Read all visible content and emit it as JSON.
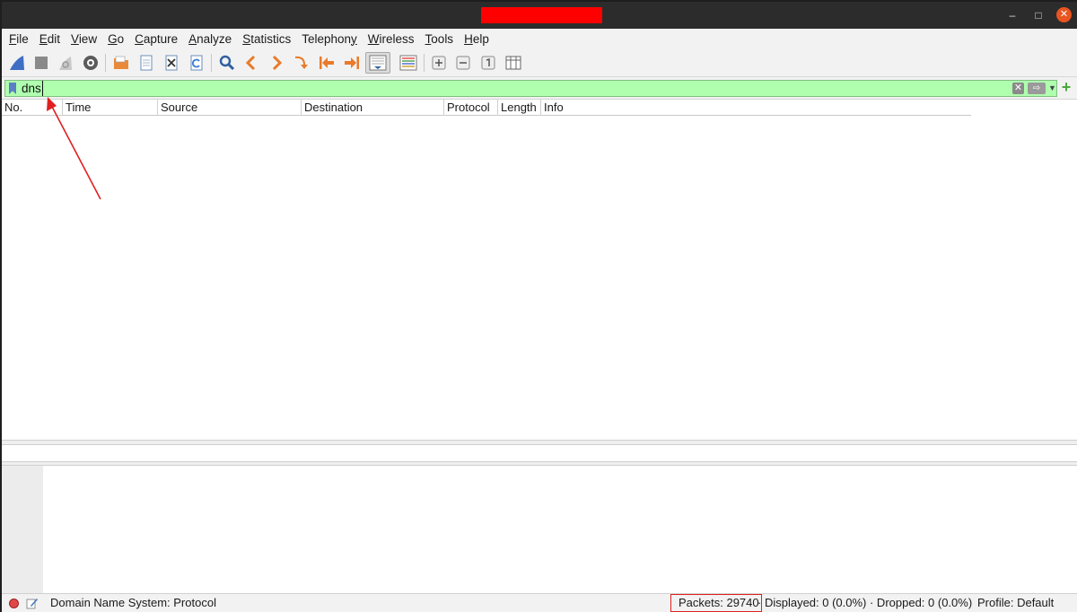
{
  "window": {
    "title_redacted": true,
    "controls": {
      "minimize": "–",
      "maximize": "□",
      "close": "✕"
    }
  },
  "menu": {
    "items": [
      {
        "label": "File",
        "mnemonic": "F",
        "rest": "ile"
      },
      {
        "label": "Edit",
        "mnemonic": "E",
        "rest": "dit"
      },
      {
        "label": "View",
        "mnemonic": "V",
        "rest": "iew"
      },
      {
        "label": "Go",
        "mnemonic": "G",
        "rest": "o"
      },
      {
        "label": "Capture",
        "mnemonic": "C",
        "rest": "apture"
      },
      {
        "label": "Analyze",
        "mnemonic": "A",
        "rest": "nalyze"
      },
      {
        "label": "Statistics",
        "mnemonic": "S",
        "rest": "tatistics"
      },
      {
        "label": "Telephony",
        "mnemonic": "y",
        "pre": "Telephon"
      },
      {
        "label": "Wireless",
        "mnemonic": "W",
        "rest": "ireless"
      },
      {
        "label": "Tools",
        "mnemonic": "T",
        "rest": "ools"
      },
      {
        "label": "Help",
        "mnemonic": "H",
        "rest": "elp"
      }
    ]
  },
  "toolbar": {
    "icons": [
      "shark-fin-icon",
      "stop-icon",
      "restart-icon",
      "capture-options-icon",
      "open-folder-icon",
      "file-icon",
      "close-file-icon",
      "reload-icon",
      "find-icon",
      "back-icon",
      "forward-icon",
      "go-to-packet-icon",
      "first-packet-icon",
      "last-packet-icon",
      "autoscroll-icon",
      "colorize-icon",
      "zoom-in-icon",
      "zoom-out-icon",
      "normal-size-icon",
      "resize-columns-icon"
    ]
  },
  "filter": {
    "value": "dns",
    "valid": true,
    "color": "#afffaf"
  },
  "packet_list": {
    "columns": [
      "No.",
      "Time",
      "Source",
      "Destination",
      "Protocol",
      "Length",
      "Info"
    ],
    "rows": []
  },
  "status": {
    "field_info": "Domain Name System: Protocol",
    "packets": "Packets: 29740",
    "displayed": "· Displayed: 0 (0.0%) · Dropped: 0 (0.0%)",
    "profile": "Profile: Default"
  },
  "colors": {
    "filter_valid": "#afffaf",
    "annotation": "#e02020",
    "close_button": "#e95420"
  }
}
